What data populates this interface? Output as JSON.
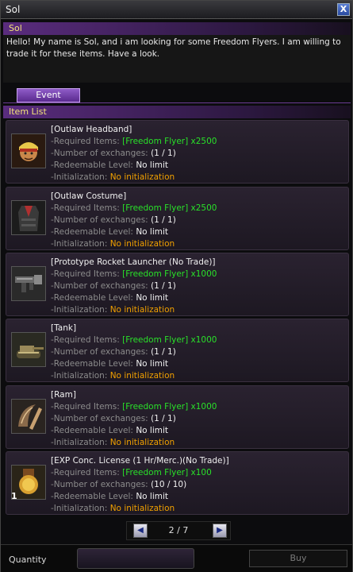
{
  "window": {
    "title": "Sol",
    "close_label": "X"
  },
  "npc": {
    "name": "Sol",
    "dialog": "Hello! My name is Sol, and i am looking for some Freedom Flyers. I am willing to trade it for these items. Have a look."
  },
  "tabs": [
    {
      "label": "Event",
      "active": true
    }
  ],
  "item_list": {
    "header": "Item List",
    "labels": {
      "required": "-Required Items:",
      "exchanges": "-Number of exchanges:",
      "level": "-Redeemable Level:",
      "init": "-Initialization:"
    },
    "items": [
      {
        "name": "[Outlaw Headband]",
        "required": "[Freedom Flyer] x2500",
        "exchanges": "(1 / 1)",
        "level": "No limit",
        "init": "No initialization",
        "icon": "headband-icon",
        "qty": ""
      },
      {
        "name": "[Outlaw Costume]",
        "required": "[Freedom Flyer] x2500",
        "exchanges": "(1 / 1)",
        "level": "No limit",
        "init": "No initialization",
        "icon": "costume-icon",
        "qty": ""
      },
      {
        "name": "[Prototype Rocket Launcher (No Trade)]",
        "required": "[Freedom Flyer] x1000",
        "exchanges": "(1 / 1)",
        "level": "No limit",
        "init": "No initialization",
        "icon": "rocket-launcher-icon",
        "qty": ""
      },
      {
        "name": "[Tank]",
        "required": "[Freedom Flyer] x1000",
        "exchanges": "(1 / 1)",
        "level": "No limit",
        "init": "No initialization",
        "icon": "tank-icon",
        "qty": ""
      },
      {
        "name": "[Ram]",
        "required": "[Freedom Flyer] x1000",
        "exchanges": "(1 / 1)",
        "level": "No limit",
        "init": "No initialization",
        "icon": "ram-icon",
        "qty": ""
      },
      {
        "name": "[EXP Conc. License (1 Hr/Merc.)(No Trade)]",
        "required": "[Freedom Flyer] x100",
        "exchanges": "(10 / 10)",
        "level": "No limit",
        "init": "No initialization",
        "icon": "exp-license-icon",
        "qty": "1"
      }
    ]
  },
  "pager": {
    "text": "2 / 7",
    "prev": "◀",
    "next": "▶"
  },
  "bottom": {
    "quantity_label": "Quantity",
    "quantity_value": "",
    "buy_label": "Buy"
  },
  "colors": {
    "accent": "#5a2c7e",
    "green": "#29e029",
    "orange": "#f0a000",
    "yellow": "#f3e37a"
  }
}
